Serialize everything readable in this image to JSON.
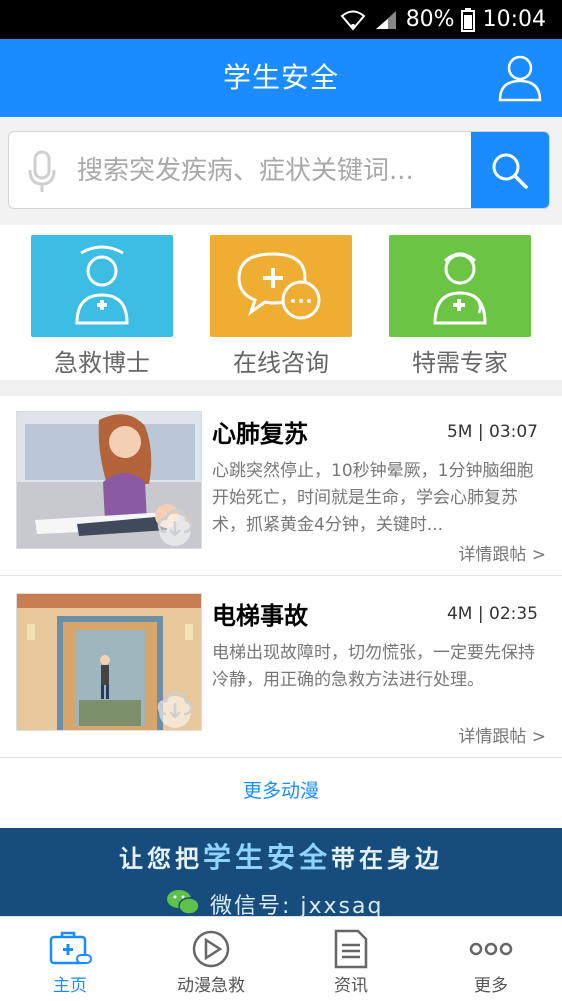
{
  "status_bar": {
    "battery": "80%",
    "time": "10:04"
  },
  "header": {
    "title": "学生安全"
  },
  "search": {
    "placeholder": "搜索突发疾病、症状关键词..."
  },
  "quick_actions": [
    {
      "label": "急救博士",
      "color": "#3bbde4",
      "icon": "doctor-icon"
    },
    {
      "label": "在线咨询",
      "color": "#efad32",
      "icon": "chat-bubbles-icon"
    },
    {
      "label": "特需专家",
      "color": "#6cc445",
      "icon": "specialist-icon"
    }
  ],
  "cards": [
    {
      "title": "心肺复苏",
      "meta": "5M | 03:07",
      "desc": "心跳突然停止，10秒钟晕厥，1分钟脑细胞开始死亡，时间就是生命，学会心肺复苏术，抓紧黄金4分钟，关键时...",
      "more": "详情跟帖 >"
    },
    {
      "title": "电梯事故",
      "meta": "4M | 02:35",
      "desc": "电梯出现故障时，切勿慌张，一定要先保持冷静，用正确的急救方法进行处理。",
      "more": "详情跟帖 >"
    }
  ],
  "more_animations": "更多动漫",
  "banner": {
    "line1_a": "让您把",
    "line1_b": "学生安全",
    "line1_c": "带在身边",
    "line2": "微信号: jxxsaq"
  },
  "tabs": [
    {
      "label": "主页",
      "icon": "home-medkit-icon",
      "active": true
    },
    {
      "label": "动漫急救",
      "icon": "play-icon",
      "active": false
    },
    {
      "label": "资讯",
      "icon": "document-icon",
      "active": false
    },
    {
      "label": "更多",
      "icon": "more-dots-icon",
      "active": false
    }
  ],
  "colors": {
    "accent": "#1a8cff",
    "banner": "#174d7c"
  }
}
